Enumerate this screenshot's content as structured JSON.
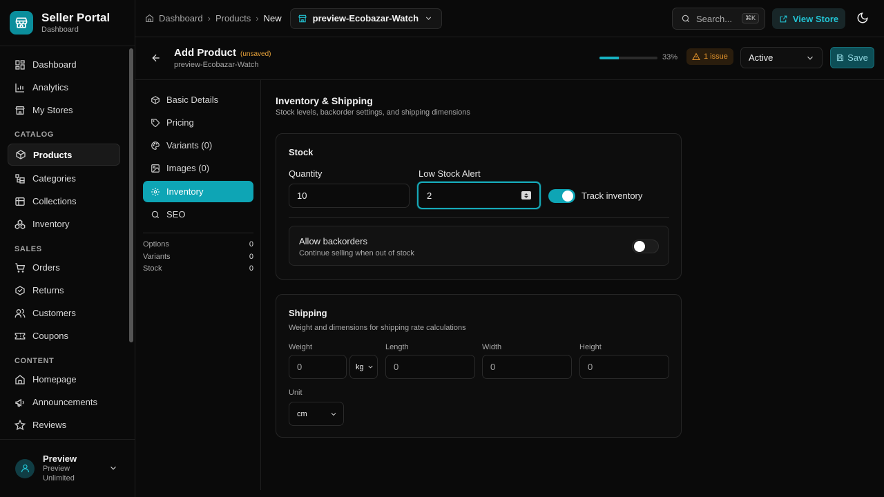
{
  "app": {
    "title": "Seller Portal",
    "subtitle": "Dashboard"
  },
  "sidebar": {
    "items_top": [
      {
        "label": "Dashboard",
        "icon": "dashboard-icon"
      },
      {
        "label": "Analytics",
        "icon": "chart-icon"
      },
      {
        "label": "My Stores",
        "icon": "store-icon"
      }
    ],
    "section_catalog": "CATALOG",
    "items_catalog": [
      {
        "label": "Products",
        "icon": "box-icon"
      },
      {
        "label": "Categories",
        "icon": "categories-icon"
      },
      {
        "label": "Collections",
        "icon": "collections-icon"
      },
      {
        "label": "Inventory",
        "icon": "inventory-icon"
      }
    ],
    "section_sales": "SALES",
    "items_sales": [
      {
        "label": "Orders",
        "icon": "cart-icon"
      },
      {
        "label": "Returns",
        "icon": "returns-icon"
      },
      {
        "label": "Customers",
        "icon": "users-icon"
      },
      {
        "label": "Coupons",
        "icon": "ticket-icon"
      }
    ],
    "section_content": "CONTENT",
    "items_content": [
      {
        "label": "Homepage",
        "icon": "home-icon"
      },
      {
        "label": "Announcements",
        "icon": "megaphone-icon"
      },
      {
        "label": "Reviews",
        "icon": "star-icon"
      }
    ],
    "user": {
      "name": "Preview",
      "plan": "Preview",
      "tier": "Unlimited"
    }
  },
  "topbar": {
    "breadcrumb": [
      "Dashboard",
      "Products",
      "New"
    ],
    "store": "preview-Ecobazar-Watch",
    "search_placeholder": "Search...",
    "search_shortcut": "⌘K",
    "view_store": "View Store"
  },
  "product_header": {
    "title": "Add Product",
    "unsaved": "(unsaved)",
    "store": "preview-Ecobazar-Watch",
    "progress": 0.33,
    "progress_label": "33%",
    "issues": "1 issue",
    "status": "Active",
    "save": "Save"
  },
  "tabs": [
    {
      "label": "Basic Details",
      "icon": "cube-icon"
    },
    {
      "label": "Pricing",
      "icon": "tag-icon"
    },
    {
      "label": "Variants (0)",
      "icon": "palette-icon"
    },
    {
      "label": "Images (0)",
      "icon": "image-icon"
    },
    {
      "label": "Inventory",
      "icon": "gear-icon"
    },
    {
      "label": "SEO",
      "icon": "search-icon"
    }
  ],
  "stats": [
    {
      "label": "Options",
      "value": "0"
    },
    {
      "label": "Variants",
      "value": "0"
    },
    {
      "label": "Stock",
      "value": "0"
    }
  ],
  "section": {
    "title": "Inventory & Shipping",
    "subtitle": "Stock levels, backorder settings, and shipping dimensions"
  },
  "stock": {
    "title": "Stock",
    "quantity_label": "Quantity",
    "quantity": "10",
    "low_stock_label": "Low Stock Alert",
    "low_stock": "2",
    "track_label": "Track inventory",
    "track_enabled": true,
    "backorders_title": "Allow backorders",
    "backorders_sub": "Continue selling when out of stock",
    "backorders_enabled": false
  },
  "shipping": {
    "title": "Shipping",
    "subtitle": "Weight and dimensions for shipping rate calculations",
    "weight_label": "Weight",
    "weight": "0",
    "weight_unit": "kg",
    "length_label": "Length",
    "length": "0",
    "width_label": "Width",
    "width": "0",
    "height_label": "Height",
    "height": "0",
    "unit_label": "Unit",
    "unit": "cm"
  },
  "colors": {
    "accent": "#0ea5b5",
    "warning": "#e5952c"
  }
}
